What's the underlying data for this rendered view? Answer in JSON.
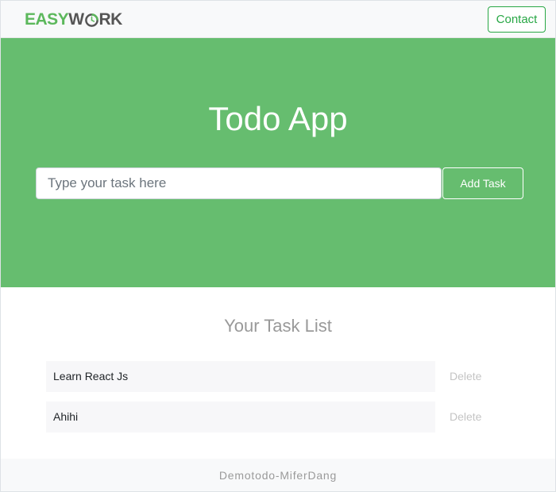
{
  "navbar": {
    "logo_part1": "EASY",
    "logo_part2_w": "W",
    "logo_part2_rest": "RK",
    "contact_label": "Contact"
  },
  "hero": {
    "title": "Todo App",
    "input_placeholder": "Type your task here",
    "input_value": "",
    "add_label": "Add Task"
  },
  "task_list": {
    "title": "Your Task List",
    "items": [
      {
        "text": "Learn React Js",
        "delete_label": "Delete"
      },
      {
        "text": "Ahihi",
        "delete_label": "Delete"
      }
    ]
  },
  "footer": {
    "text": "Demotodo-MiferDang"
  },
  "colors": {
    "brand_green": "#66bd6f",
    "button_green": "#28a745",
    "logo_green": "#5cb85c"
  },
  "icons": {
    "logo_clock": "clock-icon"
  }
}
